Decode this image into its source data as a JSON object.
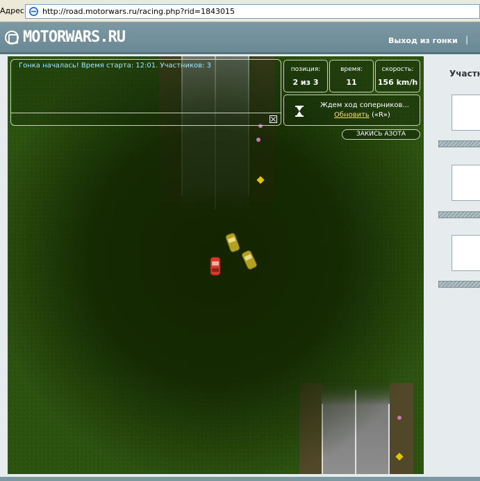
{
  "browser": {
    "address_label": "Адрес:",
    "url": "http://road.motorwars.ru/racing.php?rid=1843015"
  },
  "header": {
    "logo": "MOTORWARS.RU",
    "exit_label": "Выход из гонки",
    "separator": "|"
  },
  "race": {
    "message": "Гонка началась! Время старта: 12:01. Участников: 3",
    "stats": {
      "position_label": "позиция:",
      "position_value": "2 из 3",
      "time_label": "время:",
      "time_value": "11",
      "speed_label": "скорость:",
      "speed_value": "156 km/h"
    },
    "waiting_text": "Ждем ход соперников...",
    "refresh_label": "Обновить",
    "refresh_hotkey": "(«R»)",
    "nitro_label": "ЗАКИСЬ АЗОТА",
    "cars": [
      {
        "name": "player-car",
        "color": "#d63a2a"
      },
      {
        "name": "rival-car-1",
        "color": "#b3a021"
      },
      {
        "name": "rival-car-2",
        "color": "#b3a021"
      }
    ]
  },
  "sidebar": {
    "title": "Участн",
    "participant_slots": 3
  },
  "colors": {
    "header_bg": "#6a8893",
    "grass": "#1a3200",
    "road": "#8a8a8a",
    "stat_text": "#ffffff",
    "message_text": "#9fe6ff",
    "link": "#f3e06a"
  }
}
